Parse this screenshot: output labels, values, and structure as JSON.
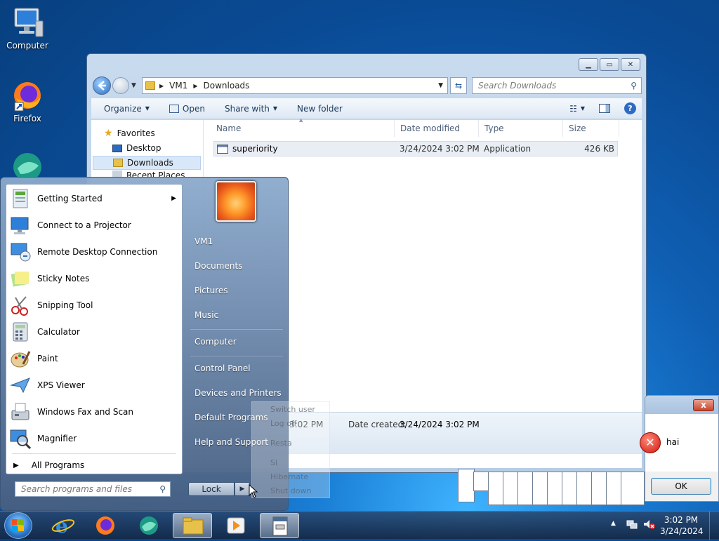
{
  "desktop": {
    "icons": [
      {
        "label": "Computer"
      },
      {
        "label": "Firefox"
      }
    ]
  },
  "explorer": {
    "breadcrumb": [
      "VM1",
      "Downloads"
    ],
    "search_placeholder": "Search Downloads",
    "toolbar": {
      "organize": "Organize",
      "open": "Open",
      "share_with": "Share with",
      "new_folder": "New folder"
    },
    "nav": {
      "favorites": "Favorites",
      "desktop": "Desktop",
      "downloads": "Downloads",
      "recent_places": "Recent Places"
    },
    "columns": {
      "name": "Name",
      "date_modified": "Date modified",
      "type": "Type",
      "size": "Size"
    },
    "files": [
      {
        "name": "superiority",
        "date_modified": "3/24/2024 3:02 PM",
        "type": "Application",
        "size": "426 KB"
      }
    ],
    "details": {
      "modified_value": "3:02 PM",
      "created_label": "Date created:",
      "created_value": "3/24/2024 3:02 PM"
    }
  },
  "message_box": {
    "text": "hai",
    "ok_label": "OK",
    "close_label": "x"
  },
  "start_menu": {
    "programs": [
      {
        "label": "Getting Started"
      },
      {
        "label": "Connect to a Projector"
      },
      {
        "label": "Remote Desktop Connection"
      },
      {
        "label": "Sticky Notes"
      },
      {
        "label": "Snipping Tool"
      },
      {
        "label": "Calculator"
      },
      {
        "label": "Paint"
      },
      {
        "label": "XPS Viewer"
      },
      {
        "label": "Windows Fax and Scan"
      },
      {
        "label": "Magnifier"
      }
    ],
    "all_programs": "All Programs",
    "search_placeholder": "Search programs and files",
    "right": {
      "user": "VM1",
      "documents": "Documents",
      "pictures": "Pictures",
      "music": "Music",
      "computer": "Computer",
      "control_panel": "Control Panel",
      "devices": "Devices and Printers",
      "default_programs": "Default Programs",
      "help": "Help and Support"
    },
    "lock_label": "Lock",
    "power_menu": {
      "switch_user": "Switch user",
      "log_off": "Log off",
      "restart": "Resta",
      "sleep": "Sl",
      "hibernate": "Hibernate",
      "shut_down": "Shut down"
    }
  },
  "taskbar": {
    "time": "3:02 PM",
    "date": "3/24/2024"
  }
}
